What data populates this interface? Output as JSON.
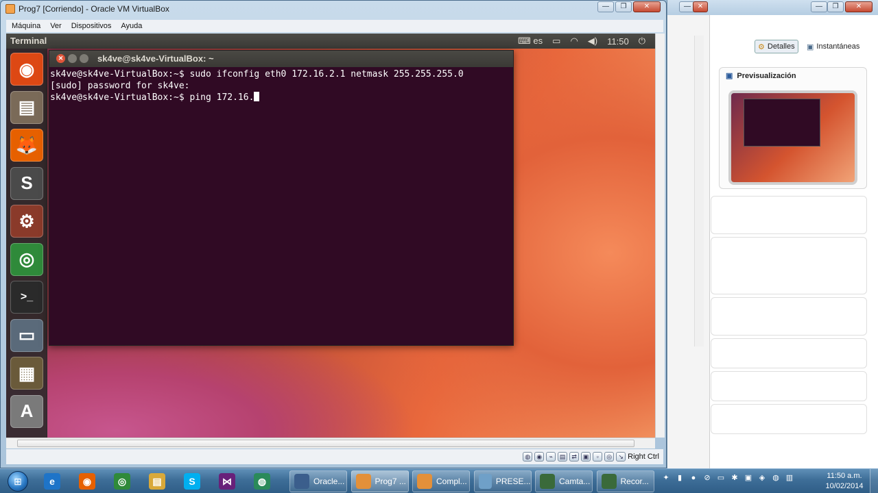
{
  "vm_window": {
    "title": "Prog7 [Corriendo] - Oracle VM VirtualBox",
    "menu": [
      "Máquina",
      "Ver",
      "Dispositivos",
      "Ayuda"
    ],
    "status_right": "Right Ctrl"
  },
  "guest": {
    "topbar": {
      "app_name": "Terminal",
      "keyboard": "es",
      "time": "11:50",
      "icons": [
        "keyboard-icon",
        "battery-icon",
        "wifi-icon",
        "volume-icon",
        "power-icon"
      ]
    },
    "launcher": [
      {
        "name": "ubuntu-dash-icon",
        "glyph": "◉",
        "color": "#dd4814"
      },
      {
        "name": "files-icon",
        "glyph": "▤",
        "color": "#7a6a58"
      },
      {
        "name": "firefox-icon",
        "glyph": "🦊",
        "color": "#e66000"
      },
      {
        "name": "sublime-text-icon",
        "glyph": "S",
        "color": "#4a4a4a"
      },
      {
        "name": "system-settings-icon",
        "glyph": "⚙",
        "color": "#8a3a2a"
      },
      {
        "name": "chrome-icon",
        "glyph": "◎",
        "color": "#2f8a3a"
      },
      {
        "name": "terminal-icon",
        "glyph": ">_",
        "color": "#2a2a2a"
      },
      {
        "name": "remote-desktop-icon",
        "glyph": "▭",
        "color": "#5a6a7a"
      },
      {
        "name": "workspace-switcher-icon",
        "glyph": "▦",
        "color": "#6a5a3a"
      },
      {
        "name": "software-updater-icon",
        "glyph": "A",
        "color": "#7a7a7a"
      }
    ],
    "terminal": {
      "title": "sk4ve@sk4ve-VirtualBox: ~",
      "lines": [
        "sk4ve@sk4ve-VirtualBox:~$ sudo ifconfig eth0 172.16.2.1 netmask 255.255.255.0",
        "[sudo] password for sk4ve:",
        "sk4ve@sk4ve-VirtualBox:~$ ping 172.16."
      ]
    }
  },
  "manager": {
    "details_label": "Detalles",
    "snapshots_label": "Instantáneas",
    "preview_label": "Previsualización"
  },
  "taskbar": {
    "pinned": [
      {
        "name": "ie-icon",
        "glyph": "e",
        "color": "#1e74c8"
      },
      {
        "name": "firefox-icon",
        "glyph": "◉",
        "color": "#e66000"
      },
      {
        "name": "chrome-icon",
        "glyph": "◎",
        "color": "#2f8a3a"
      },
      {
        "name": "explorer-icon",
        "glyph": "▤",
        "color": "#d9a93a"
      },
      {
        "name": "skype-icon",
        "glyph": "S",
        "color": "#00aff0"
      },
      {
        "name": "visual-studio-icon",
        "glyph": "⋈",
        "color": "#68217a"
      },
      {
        "name": "network-icon",
        "glyph": "◍",
        "color": "#2a8a5a"
      }
    ],
    "tasks": [
      {
        "label": "Oracle...",
        "icon": "virtualbox-icon",
        "color": "#3b5e8c",
        "active": false
      },
      {
        "label": "Prog7 ...",
        "icon": "vm-icon",
        "color": "#e3903a",
        "active": true
      },
      {
        "label": "Compl...",
        "icon": "vm-icon",
        "color": "#e3903a",
        "active": false
      },
      {
        "label": "PRESE...",
        "icon": "powerpoint-icon",
        "color": "#6fa0c8",
        "active": false
      },
      {
        "label": "Camta...",
        "icon": "camtasia-icon",
        "color": "#3a6a3a",
        "active": false
      },
      {
        "label": "Recor...",
        "icon": "recorder-icon",
        "color": "#3a6a3a",
        "active": false
      }
    ],
    "clock_time": "11:50 a.m.",
    "clock_date": "10/02/2014"
  }
}
